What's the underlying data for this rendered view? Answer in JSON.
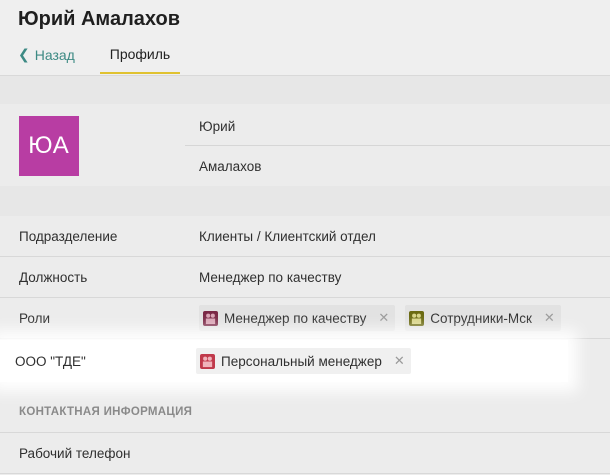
{
  "header": {
    "title": "Юрий Амалахов",
    "back_label": "Назад",
    "tab_profile": "Профиль"
  },
  "profile": {
    "initials": "ЮА",
    "first_name": "Юрий",
    "last_name": "Амалахов",
    "avatar_color": "#b83da3"
  },
  "fields": {
    "department_label": "Подразделение",
    "department_value": "Клиенты / Клиентский отдел",
    "position_label": "Должность",
    "position_value": "Менеджер по качеству",
    "roles_label": "Роли",
    "roles": [
      {
        "name": "Менеджер по качеству",
        "icon_color": "#7a2846"
      },
      {
        "name": "Сотрудники-Мск",
        "icon_color": "#6b6a12"
      }
    ],
    "org_label": "ООО \"ТДЕ\"",
    "org_roles": [
      {
        "name": "Персональный менеджер",
        "icon_color": "#c0394b"
      }
    ]
  },
  "contacts": {
    "section_title": "КОНТАКТНАЯ ИНФОРМАЦИЯ",
    "work_phone_label": "Рабочий телефон"
  },
  "colors": {
    "accent_tab_underline": "#e0c230",
    "link": "#3d8a84"
  }
}
